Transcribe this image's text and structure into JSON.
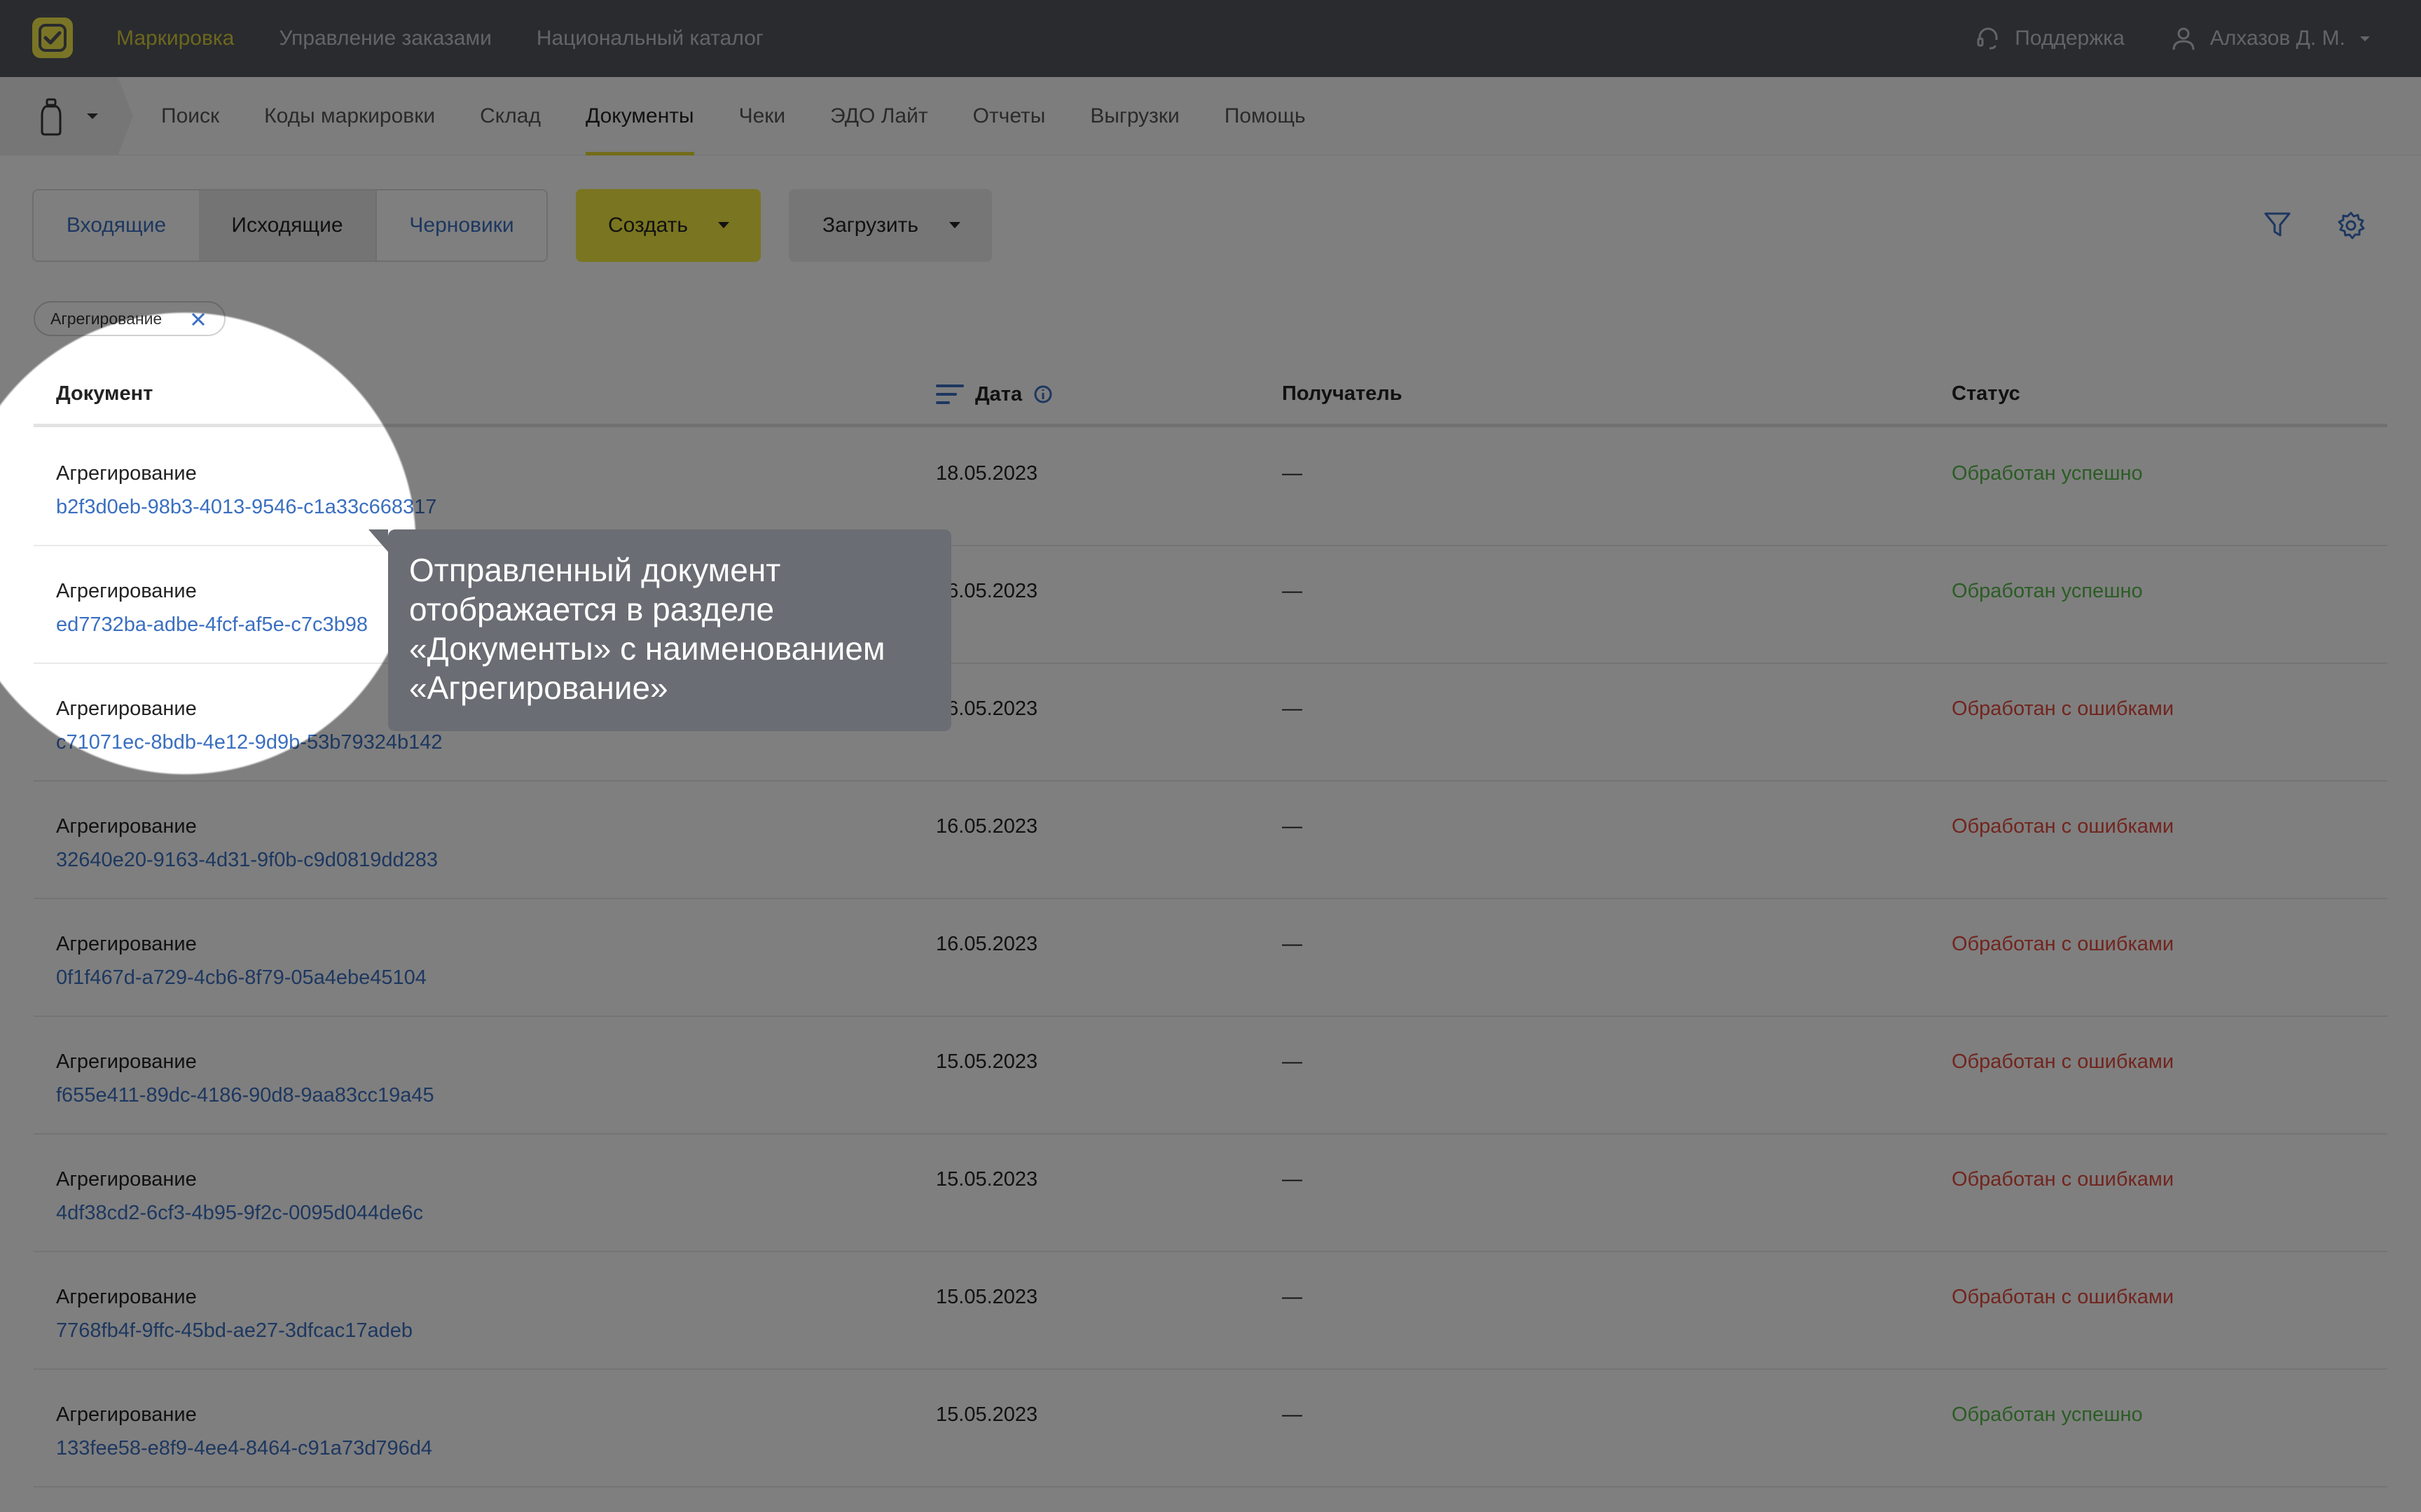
{
  "topbar": {
    "nav": [
      "Маркировка",
      "Управление заказами",
      "Национальный каталог"
    ],
    "support": "Поддержка",
    "user": "Алхазов Д. М."
  },
  "subnav": {
    "tabs": [
      "Поиск",
      "Коды маркировки",
      "Склад",
      "Документы",
      "Чеки",
      "ЭДО Лайт",
      "Отчеты",
      "Выгрузки",
      "Помощь"
    ],
    "active_tab": "Документы"
  },
  "toolbar": {
    "segments": [
      "Входящие",
      "Исходящие",
      "Черновики"
    ],
    "active_segment": "Исходящие",
    "create_label": "Создать",
    "upload_label": "Загрузить"
  },
  "filter_chip": "Агрегирование",
  "table": {
    "columns": [
      "Документ",
      "Дата",
      "Получатель",
      "Статус"
    ],
    "rows": [
      {
        "name": "Агрегирование",
        "uuid": "b2f3d0eb-98b3-4013-9546-c1a33c668317",
        "date": "18.05.2023",
        "recipient": "—",
        "status": "Обработан успешно",
        "state": "ok"
      },
      {
        "name": "Агрегирование",
        "uuid": "ed7732ba-adbe-4fcf-af5e-c7c3b98",
        "date": "16.05.2023",
        "recipient": "—",
        "status": "Обработан успешно",
        "state": "ok"
      },
      {
        "name": "Агрегирование",
        "uuid": "c71071ec-8bdb-4e12-9d9b-53b79324b142",
        "date": "16.05.2023",
        "recipient": "—",
        "status": "Обработан с ошибками",
        "state": "err"
      },
      {
        "name": "Агрегирование",
        "uuid": "32640e20-9163-4d31-9f0b-c9d0819dd283",
        "date": "16.05.2023",
        "recipient": "—",
        "status": "Обработан с ошибками",
        "state": "err"
      },
      {
        "name": "Агрегирование",
        "uuid": "0f1f467d-a729-4cb6-8f79-05a4ebe45104",
        "date": "16.05.2023",
        "recipient": "—",
        "status": "Обработан с ошибками",
        "state": "err"
      },
      {
        "name": "Агрегирование",
        "uuid": "f655e411-89dc-4186-90d8-9aa83cc19a45",
        "date": "15.05.2023",
        "recipient": "—",
        "status": "Обработан с ошибками",
        "state": "err"
      },
      {
        "name": "Агрегирование",
        "uuid": "4df38cd2-6cf3-4b95-9f2c-0095d044de6c",
        "date": "15.05.2023",
        "recipient": "—",
        "status": "Обработан с ошибками",
        "state": "err"
      },
      {
        "name": "Агрегирование",
        "uuid": "7768fb4f-9ffc-45bd-ae27-3dfcac17adeb",
        "date": "15.05.2023",
        "recipient": "—",
        "status": "Обработан с ошибками",
        "state": "err"
      },
      {
        "name": "Агрегирование",
        "uuid": "133fee58-e8f9-4ee4-8464-c91a73d796d4",
        "date": "15.05.2023",
        "recipient": "—",
        "status": "Обработан успешно",
        "state": "ok"
      }
    ]
  },
  "tooltip": {
    "lines": [
      "Отправленный документ",
      "отображается в разделе",
      "«Документы» с наименованием",
      "«Агрегирование»"
    ]
  },
  "colors": {
    "brand": "#f4ea40",
    "link": "#3a6fc0",
    "success": "#57b84a",
    "error": "#e24a3d"
  }
}
